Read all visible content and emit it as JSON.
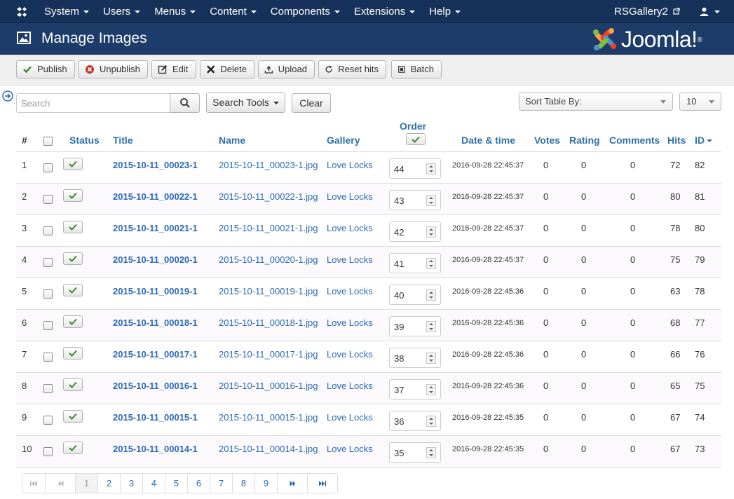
{
  "nav": {
    "menu": [
      "System",
      "Users",
      "Menus",
      "Content",
      "Components",
      "Extensions",
      "Help"
    ],
    "site_link": "RSGallery2"
  },
  "header": {
    "title": "Manage Images",
    "brand": "Joomla!"
  },
  "toolbar": {
    "publish": "Publish",
    "unpublish": "Unpublish",
    "edit": "Edit",
    "delete": "Delete",
    "upload": "Upload",
    "reset_hits": "Reset hits",
    "batch": "Batch"
  },
  "filters": {
    "search_placeholder": "Search",
    "search_tools": "Search Tools",
    "clear": "Clear",
    "sort_placeholder": "Sort Table By:",
    "limit": "10"
  },
  "columns": {
    "num": "#",
    "status": "Status",
    "title": "Title",
    "name": "Name",
    "gallery": "Gallery",
    "order": "Order",
    "date": "Date & time",
    "votes": "Votes",
    "rating": "Rating",
    "comments": "Comments",
    "hits": "Hits",
    "id": "ID"
  },
  "rows": [
    {
      "num": "1",
      "title": "2015-10-11_00023-1",
      "name": "2015-10-11_00023-1.jpg",
      "gallery": "Love Locks",
      "order": "44",
      "date": "2016-09-28 22:45:37",
      "votes": "0",
      "rating": "0",
      "comments": "0",
      "hits": "72",
      "id": "82"
    },
    {
      "num": "2",
      "title": "2015-10-11_00022-1",
      "name": "2015-10-11_00022-1.jpg",
      "gallery": "Love Locks",
      "order": "43",
      "date": "2016-09-28 22:45:37",
      "votes": "0",
      "rating": "0",
      "comments": "0",
      "hits": "80",
      "id": "81"
    },
    {
      "num": "3",
      "title": "2015-10-11_00021-1",
      "name": "2015-10-11_00021-1.jpg",
      "gallery": "Love Locks",
      "order": "42",
      "date": "2016-09-28 22:45:37",
      "votes": "0",
      "rating": "0",
      "comments": "0",
      "hits": "78",
      "id": "80"
    },
    {
      "num": "4",
      "title": "2015-10-11_00020-1",
      "name": "2015-10-11_00020-1.jpg",
      "gallery": "Love Locks",
      "order": "41",
      "date": "2016-09-28 22:45:37",
      "votes": "0",
      "rating": "0",
      "comments": "0",
      "hits": "75",
      "id": "79"
    },
    {
      "num": "5",
      "title": "2015-10-11_00019-1",
      "name": "2015-10-11_00019-1.jpg",
      "gallery": "Love Locks",
      "order": "40",
      "date": "2016-09-28 22:45:36",
      "votes": "0",
      "rating": "0",
      "comments": "0",
      "hits": "63",
      "id": "78"
    },
    {
      "num": "6",
      "title": "2015-10-11_00018-1",
      "name": "2015-10-11_00018-1.jpg",
      "gallery": "Love Locks",
      "order": "39",
      "date": "2016-09-28 22:45:36",
      "votes": "0",
      "rating": "0",
      "comments": "0",
      "hits": "68",
      "id": "77"
    },
    {
      "num": "7",
      "title": "2015-10-11_00017-1",
      "name": "2015-10-11_00017-1.jpg",
      "gallery": "Love Locks",
      "order": "38",
      "date": "2016-09-28 22:45:36",
      "votes": "0",
      "rating": "0",
      "comments": "0",
      "hits": "66",
      "id": "76"
    },
    {
      "num": "8",
      "title": "2015-10-11_00016-1",
      "name": "2015-10-11_00016-1.jpg",
      "gallery": "Love Locks",
      "order": "37",
      "date": "2016-09-28 22:45:36",
      "votes": "0",
      "rating": "0",
      "comments": "0",
      "hits": "65",
      "id": "75"
    },
    {
      "num": "9",
      "title": "2015-10-11_00015-1",
      "name": "2015-10-11_00015-1.jpg",
      "gallery": "Love Locks",
      "order": "36",
      "date": "2016-09-28 22:45:35",
      "votes": "0",
      "rating": "0",
      "comments": "0",
      "hits": "67",
      "id": "74"
    },
    {
      "num": "10",
      "title": "2015-10-11_00014-1",
      "name": "2015-10-11_00014-1.jpg",
      "gallery": "Love Locks",
      "order": "35",
      "date": "2016-09-28 22:45:35",
      "votes": "0",
      "rating": "0",
      "comments": "0",
      "hits": "67",
      "id": "73"
    }
  ],
  "pagination": {
    "pages": [
      "1",
      "2",
      "3",
      "4",
      "5",
      "6",
      "7",
      "8",
      "9"
    ],
    "active_page": "1",
    "first_icon": "first-page-icon",
    "prev_icon": "prev-page-icon",
    "next_icon": "next-page-icon",
    "last_icon": "last-page-icon"
  },
  "colors": {
    "navbar": "#17325a",
    "header": "#1d3c6a",
    "link": "#2a69b8",
    "check": "#3c8a2e"
  }
}
